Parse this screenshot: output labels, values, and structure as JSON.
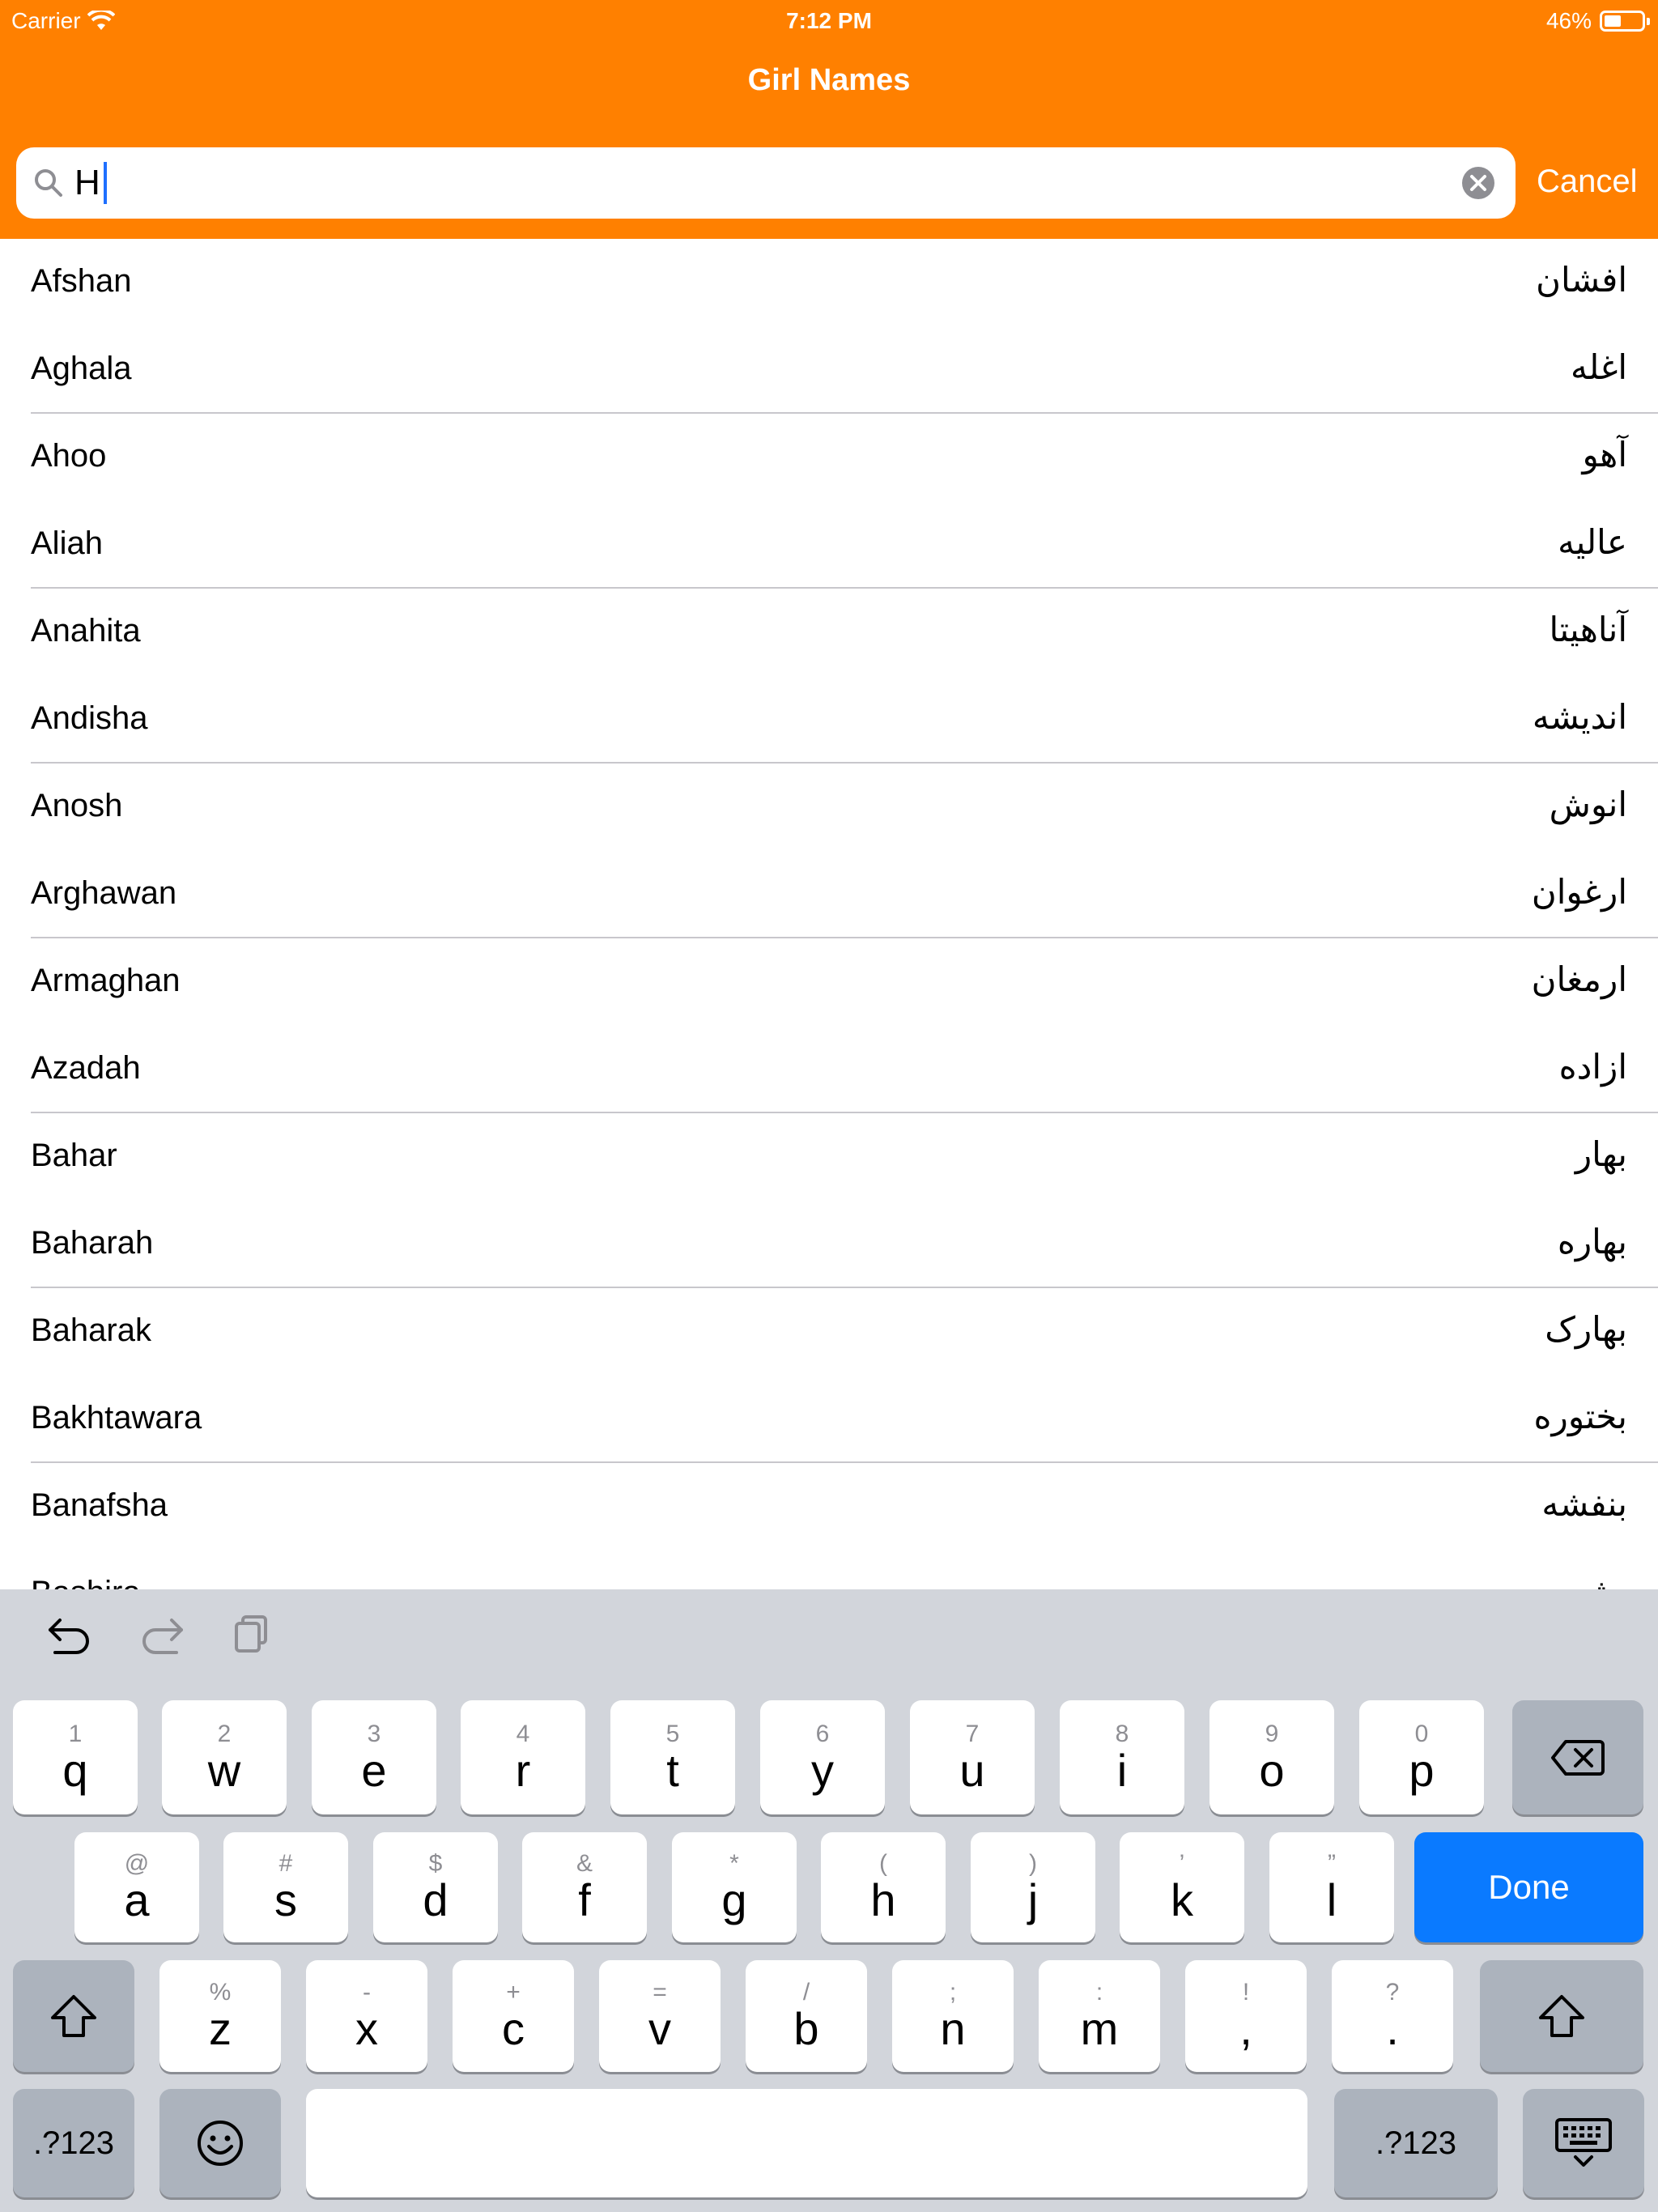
{
  "status_bar": {
    "carrier": "Carrier",
    "time": "7:12 PM",
    "battery_percent": "46%",
    "battery_level": 0.46
  },
  "nav": {
    "title": "Girl Names"
  },
  "search": {
    "value": "H",
    "cancel_label": "Cancel"
  },
  "names": [
    {
      "en": "Afshan",
      "fa": "افشان"
    },
    {
      "en": "Aghala",
      "fa": "اغله"
    },
    {
      "en": "Ahoo",
      "fa": "آهو"
    },
    {
      "en": "Aliah",
      "fa": "عالیه"
    },
    {
      "en": "Anahita",
      "fa": "آناهیتا"
    },
    {
      "en": "Andisha",
      "fa": "اندیشه"
    },
    {
      "en": "Anosh",
      "fa": "انوش"
    },
    {
      "en": "Arghawan",
      "fa": "ارغوان"
    },
    {
      "en": "Armaghan",
      "fa": "ارمغان"
    },
    {
      "en": "Azadah",
      "fa": "ازاده"
    },
    {
      "en": "Bahar",
      "fa": "بهار"
    },
    {
      "en": "Baharah",
      "fa": "بهاره"
    },
    {
      "en": "Baharak",
      "fa": "بهارک"
    },
    {
      "en": "Bakhtawara",
      "fa": "بختوره"
    },
    {
      "en": "Banafsha",
      "fa": "بنفشه"
    },
    {
      "en": "Bashira",
      "fa": "بشیره"
    }
  ],
  "keyboard": {
    "row1": [
      {
        "sub": "1",
        "main": "q"
      },
      {
        "sub": "2",
        "main": "w"
      },
      {
        "sub": "3",
        "main": "e"
      },
      {
        "sub": "4",
        "main": "r"
      },
      {
        "sub": "5",
        "main": "t"
      },
      {
        "sub": "6",
        "main": "y"
      },
      {
        "sub": "7",
        "main": "u"
      },
      {
        "sub": "8",
        "main": "i"
      },
      {
        "sub": "9",
        "main": "o"
      },
      {
        "sub": "0",
        "main": "p"
      }
    ],
    "row2": [
      {
        "sub": "@",
        "main": "a"
      },
      {
        "sub": "#",
        "main": "s"
      },
      {
        "sub": "$",
        "main": "d"
      },
      {
        "sub": "&",
        "main": "f"
      },
      {
        "sub": "*",
        "main": "g"
      },
      {
        "sub": "(",
        "main": "h"
      },
      {
        "sub": ")",
        "main": "j"
      },
      {
        "sub": "’",
        "main": "k"
      },
      {
        "sub": "”",
        "main": "l"
      }
    ],
    "row3": [
      {
        "sub": "%",
        "main": "z"
      },
      {
        "sub": "-",
        "main": "x"
      },
      {
        "sub": "+",
        "main": "c"
      },
      {
        "sub": "=",
        "main": "v"
      },
      {
        "sub": "/",
        "main": "b"
      },
      {
        "sub": ";",
        "main": "n"
      },
      {
        "sub": ":",
        "main": "m"
      },
      {
        "sub": "!",
        "main": ","
      },
      {
        "sub": "?",
        "main": "."
      }
    ],
    "done_label": "Done",
    "numbers_label": ".?123"
  },
  "colors": {
    "header": "#ff8000",
    "keyboard_bg": "#d2d5db",
    "done": "#0a7aff"
  }
}
